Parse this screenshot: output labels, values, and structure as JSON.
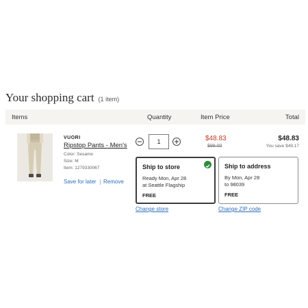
{
  "cart": {
    "title": "Your shopping cart",
    "count": "(1 item)"
  },
  "columns": {
    "items": "Items",
    "quantity": "Quantity",
    "item_price": "Item Price",
    "total": "Total"
  },
  "item": {
    "brand": "VUORI",
    "name": "Ripstop Pants - Men's",
    "color": "Color: Sesame",
    "size": "Size: M",
    "item_number": "Item: 1279330067",
    "save_for_later": "Save for later",
    "remove": "Remove",
    "quantity": "1",
    "sale_price": "$48.83",
    "original_price": "$98.00",
    "total": "$48.83",
    "savings": "You save $49.17"
  },
  "fulfillment": {
    "store": {
      "title": "Ship to store",
      "line1": "Ready Mon, Apr 28",
      "line2": "at Seattle Flagship",
      "cost": "FREE",
      "link": "Change store",
      "selected": true
    },
    "address": {
      "title": "Ship to address",
      "line1": "By Mon, Apr 28",
      "line2": "to 98039",
      "cost": "FREE",
      "link": "Change ZIP code",
      "selected": false
    }
  },
  "colors": {
    "accent_link": "#2a6ebb",
    "sale_red": "#c0391b",
    "check_green": "#2e8b3e",
    "header_bg": "#f5f4f1"
  },
  "icons": {
    "minus": "minus-icon",
    "plus": "plus-icon",
    "selected": "checkmark-icon"
  }
}
